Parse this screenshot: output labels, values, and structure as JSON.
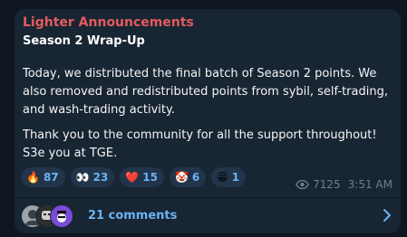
{
  "post": {
    "channel_name": "Lighter Announcements",
    "title": "Season 2 Wrap-Up",
    "paragraph1": "Today, we distributed the final batch of Season 2 points. We also removed and redistributed points from sybil, self-trading, and wash-trading activity.",
    "paragraph2": "Thank you to the community for all the support throughout! S3e you at TGE."
  },
  "reactions": [
    {
      "emoji": "🔥",
      "icon": "fire-icon",
      "count": "87"
    },
    {
      "emoji": "👀",
      "icon": "eyes-icon",
      "count": "23"
    },
    {
      "emoji": "❤️",
      "icon": "heart-icon",
      "count": "15"
    },
    {
      "emoji": "🤡",
      "icon": "clown-icon",
      "count": "6"
    },
    {
      "emoji": "😁",
      "icon": "grin-icon",
      "count": "1"
    }
  ],
  "meta": {
    "views": "7125",
    "time": "3:51 AM",
    "views_icon": "eye-icon"
  },
  "comments": {
    "label": "21 comments",
    "avatar_icons": [
      "avatar-icon",
      "avatar-icon",
      "avatar-icon"
    ],
    "chevron_icon": "chevron-right-icon"
  },
  "colors": {
    "background": "#0e1621",
    "bubble": "#182533",
    "channel_name": "#e25c5c",
    "accent": "#6ab3f3",
    "meta": "#6d7f8f"
  }
}
